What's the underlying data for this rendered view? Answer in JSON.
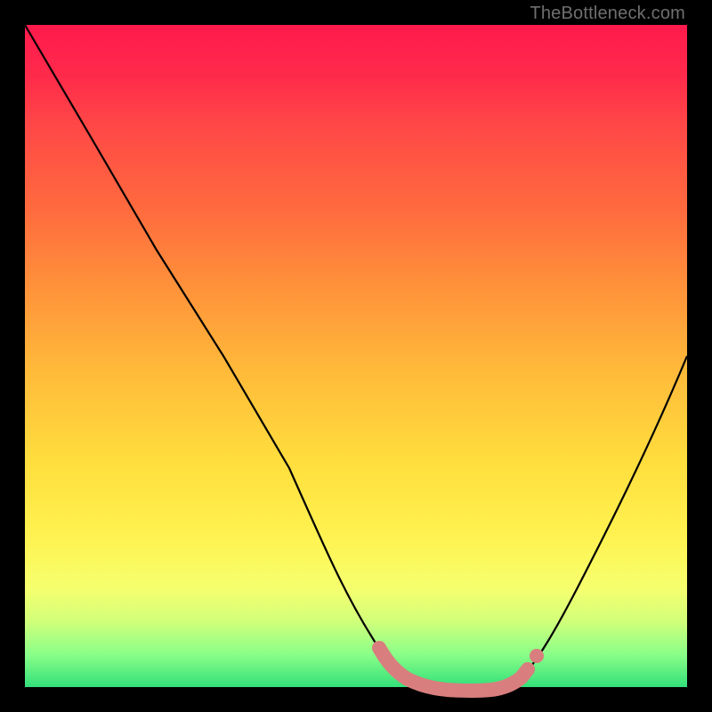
{
  "attribution": "TheBottleneck.com",
  "chart_data": {
    "type": "line",
    "title": "",
    "xlabel": "",
    "ylabel": "",
    "xlim": [
      0,
      100
    ],
    "ylim": [
      0,
      100
    ],
    "series": [
      {
        "name": "bottleneck-curve",
        "x": [
          0,
          10,
          20,
          30,
          40,
          48,
          52,
          56,
          60,
          64,
          68,
          72,
          76,
          80,
          90,
          100
        ],
        "values": [
          100,
          83,
          66,
          50,
          33,
          17,
          10,
          5,
          2,
          0,
          0,
          0,
          3,
          10,
          30,
          50
        ],
        "color": "#000000"
      },
      {
        "name": "highlight-band",
        "x": [
          52,
          56,
          60,
          64,
          68,
          72,
          76
        ],
        "values": [
          5,
          2,
          1,
          0,
          0,
          0,
          3
        ],
        "color": "#d97e7e"
      }
    ],
    "annotations": []
  },
  "colors": {
    "frame": "#000000",
    "curve": "#000000",
    "highlight": "#d97e7e",
    "attribution_text": "#6f6f6f"
  }
}
